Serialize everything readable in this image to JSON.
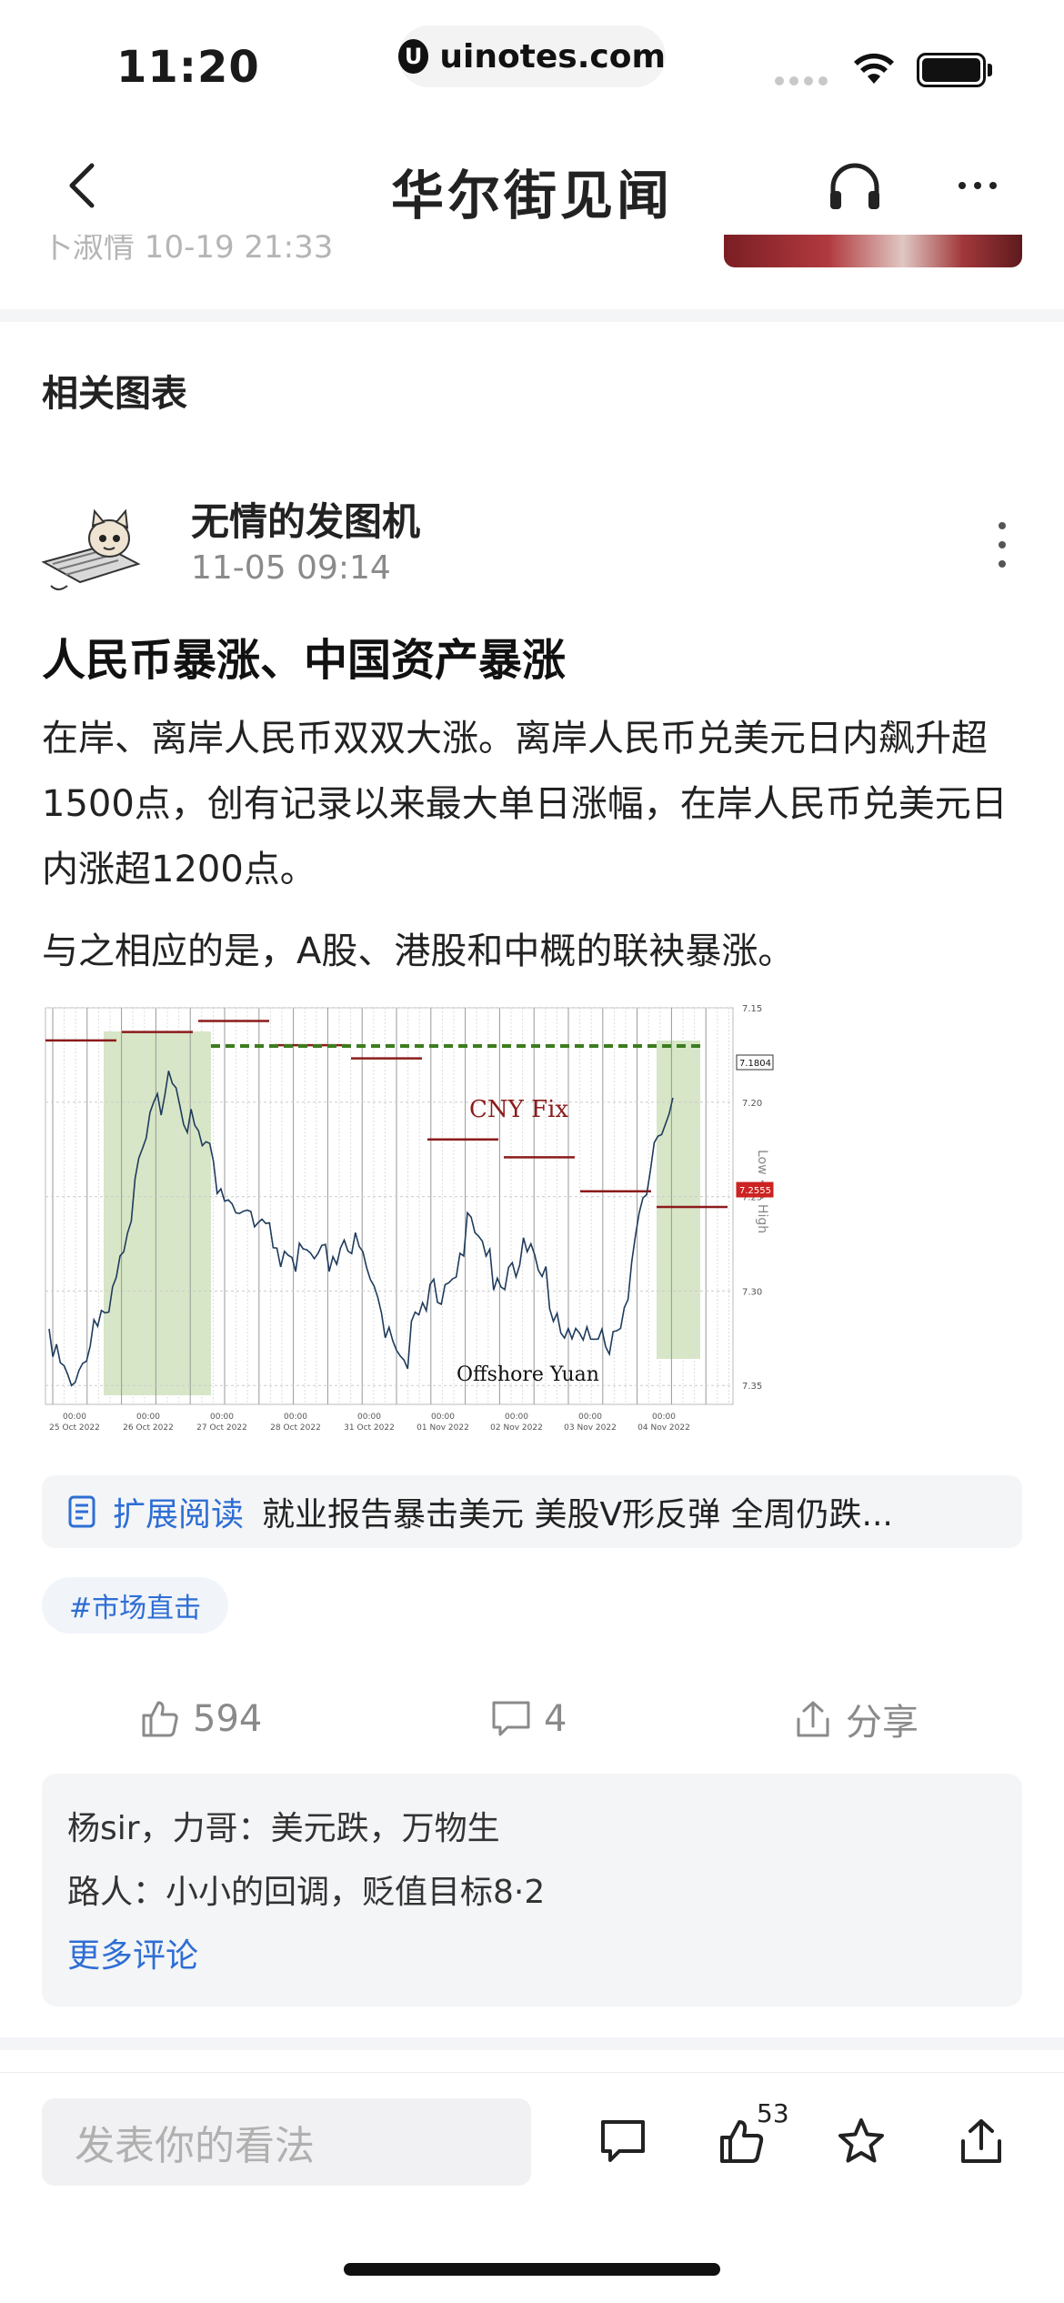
{
  "status_bar": {
    "time": "11:20",
    "url": "uinotes.com",
    "url_logo_letter": "U"
  },
  "nav": {
    "title": "华尔街见闻",
    "back_icon": "chevron-left-icon",
    "headset_icon": "headset-icon",
    "more_icon": "more-dots-icon"
  },
  "peek": {
    "text": "卜淑情  10-19 21:33"
  },
  "section": {
    "title": "相关图表"
  },
  "post": {
    "author": "无情的发图机",
    "time": "11-05 09:14",
    "title": "人民币暴涨、中国资产暴涨",
    "para1": "在岸、离岸人民币双双大涨。离岸人民币兑美元日内飙升超1500点，创有记录以来最大单日涨幅，在岸人民币兑美元日内涨超1200点。",
    "para2": "与之相应的是，A股、港股和中概的联袂暴涨。"
  },
  "chart_data": {
    "type": "line",
    "annotations": [
      "CNY Fix",
      "Offshore Yuan",
      "Low <> High"
    ],
    "x_ticks": [
      "00:00\n25 Oct 2022",
      "00:00\n26 Oct 2022",
      "00:00\n27 Oct 2022",
      "00:00\n28 Oct 2022",
      "00:00\n31 Oct 2022",
      "00:00\n01 Nov 2022",
      "00:00\n02 Nov 2022",
      "00:00\n03 Nov 2022",
      "00:00\n04 Nov 2022"
    ],
    "y_ticks": [
      "7.15",
      "7.20",
      "7.25",
      "7.30",
      "7.35"
    ],
    "y_inverted": true,
    "ylim": [
      7.36,
      7.15
    ],
    "current_labels": [
      "7.1804",
      "7.2555"
    ],
    "series": [
      {
        "name": "Offshore Yuan",
        "values": [
          7.32,
          7.35,
          7.3,
          7.24,
          7.18,
          7.22,
          7.25,
          7.27,
          7.28,
          7.29,
          7.27,
          7.31,
          7.33,
          7.3,
          7.27,
          7.29,
          7.28,
          7.31,
          7.33,
          7.32,
          7.25,
          7.18
        ]
      },
      {
        "name": "CNY Fix",
        "values": [
          7.1673,
          7.1628,
          7.157,
          7.1698,
          7.1768,
          7.2197,
          7.2292,
          7.2472,
          7.2555
        ]
      }
    ]
  },
  "ext_read": {
    "label": "扩展阅读",
    "text": "就业报告暴击美元 美股V形反弹 全周仍跌..."
  },
  "tag": "#市场直击",
  "actions": {
    "likes": "594",
    "comments": "4",
    "share": "分享"
  },
  "comments": [
    {
      "who": "杨sir，力哥：",
      "text": "美元跌，万物生"
    },
    {
      "who": "路人：",
      "text": "小小的回调，贬值目标8·2"
    }
  ],
  "more_comments": "更多评论",
  "bottom": {
    "placeholder": "发表你的看法",
    "like_count": "53"
  }
}
